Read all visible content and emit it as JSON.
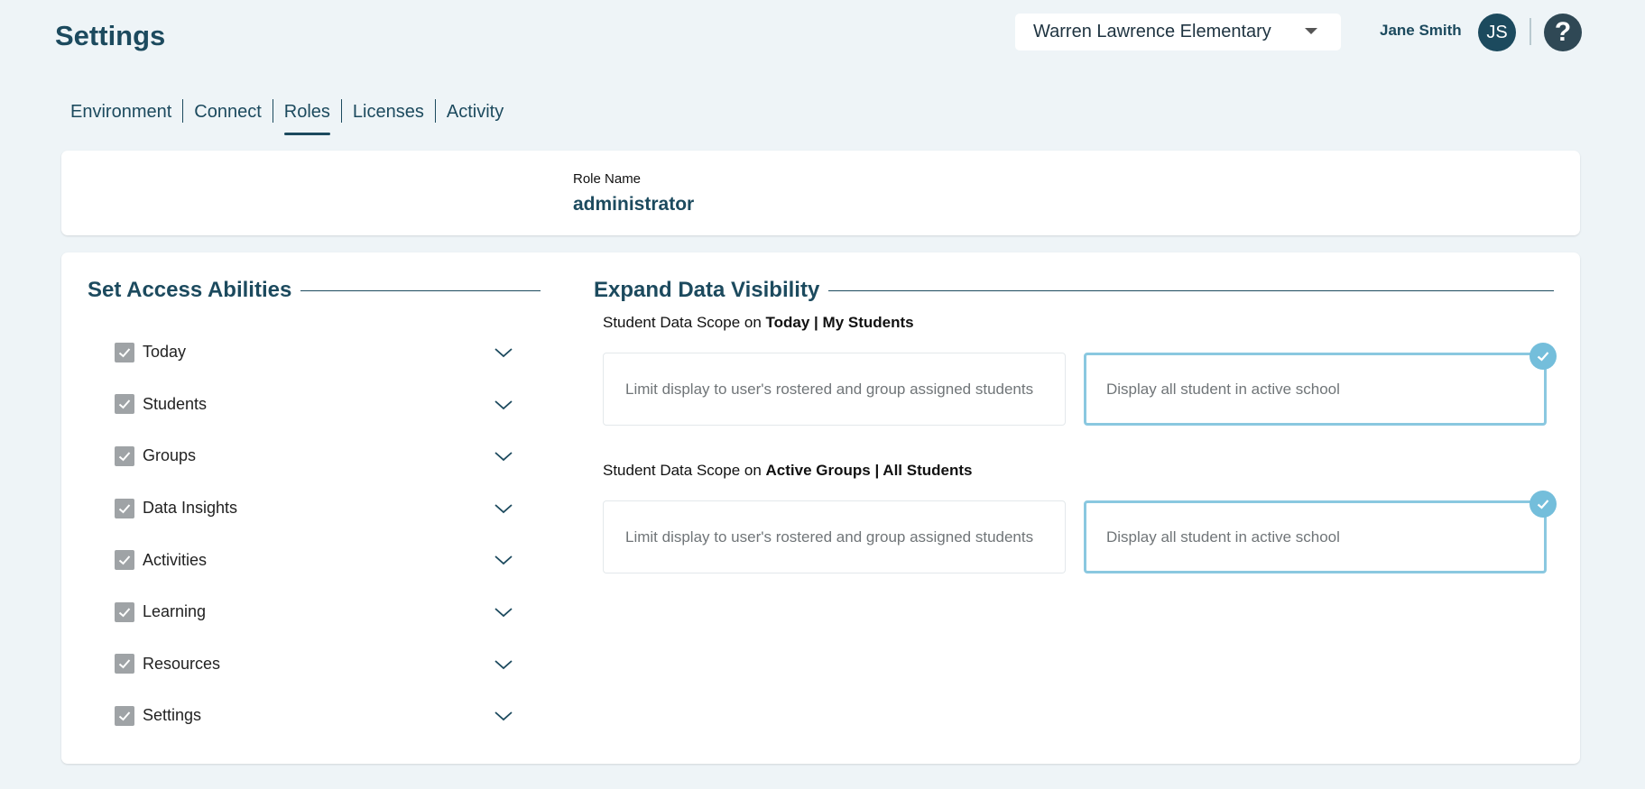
{
  "header": {
    "title": "Settings",
    "school_select": {
      "value": "Warren Lawrence Elementary"
    },
    "user": {
      "name": "Jane Smith",
      "initials": "JS"
    },
    "help_icon_glyph": "?"
  },
  "tabs": [
    {
      "label": "Environment",
      "active": false
    },
    {
      "label": "Connect",
      "active": false
    },
    {
      "label": "Roles",
      "active": true
    },
    {
      "label": "Licenses",
      "active": false
    },
    {
      "label": "Activity",
      "active": false
    }
  ],
  "role": {
    "label": "Role Name",
    "value": "administrator"
  },
  "access": {
    "title": "Set Access Abilities",
    "items": [
      {
        "label": "Today",
        "checked": true
      },
      {
        "label": "Students",
        "checked": true
      },
      {
        "label": "Groups",
        "checked": true
      },
      {
        "label": "Data Insights",
        "checked": true
      },
      {
        "label": "Activities",
        "checked": true
      },
      {
        "label": "Learning",
        "checked": true
      },
      {
        "label": "Resources",
        "checked": true
      },
      {
        "label": "Settings",
        "checked": true
      }
    ]
  },
  "visibility": {
    "title": "Expand Data Visibility",
    "scopes": [
      {
        "prefix": "Student Data Scope on ",
        "target": "Today | My Students",
        "options": [
          {
            "label": "Limit display to user's rostered and group assigned students",
            "selected": false
          },
          {
            "label": "Display all student in active school",
            "selected": true
          }
        ]
      },
      {
        "prefix": "Student Data Scope on ",
        "target": "Active Groups | All Students",
        "options": [
          {
            "label": "Limit display to user's rostered and group assigned students",
            "selected": false
          },
          {
            "label": "Display all student in active school",
            "selected": true
          }
        ]
      }
    ]
  },
  "colors": {
    "primary": "#1c4a5e",
    "background": "#eef4f7",
    "checkbox": "#9fa3a6",
    "selected_accent": "#74bedb"
  },
  "icons": {
    "checkbox": "check-icon",
    "expand": "chevron-down-icon",
    "dropdown": "caret-down-icon",
    "selected": "check-circle-icon"
  }
}
